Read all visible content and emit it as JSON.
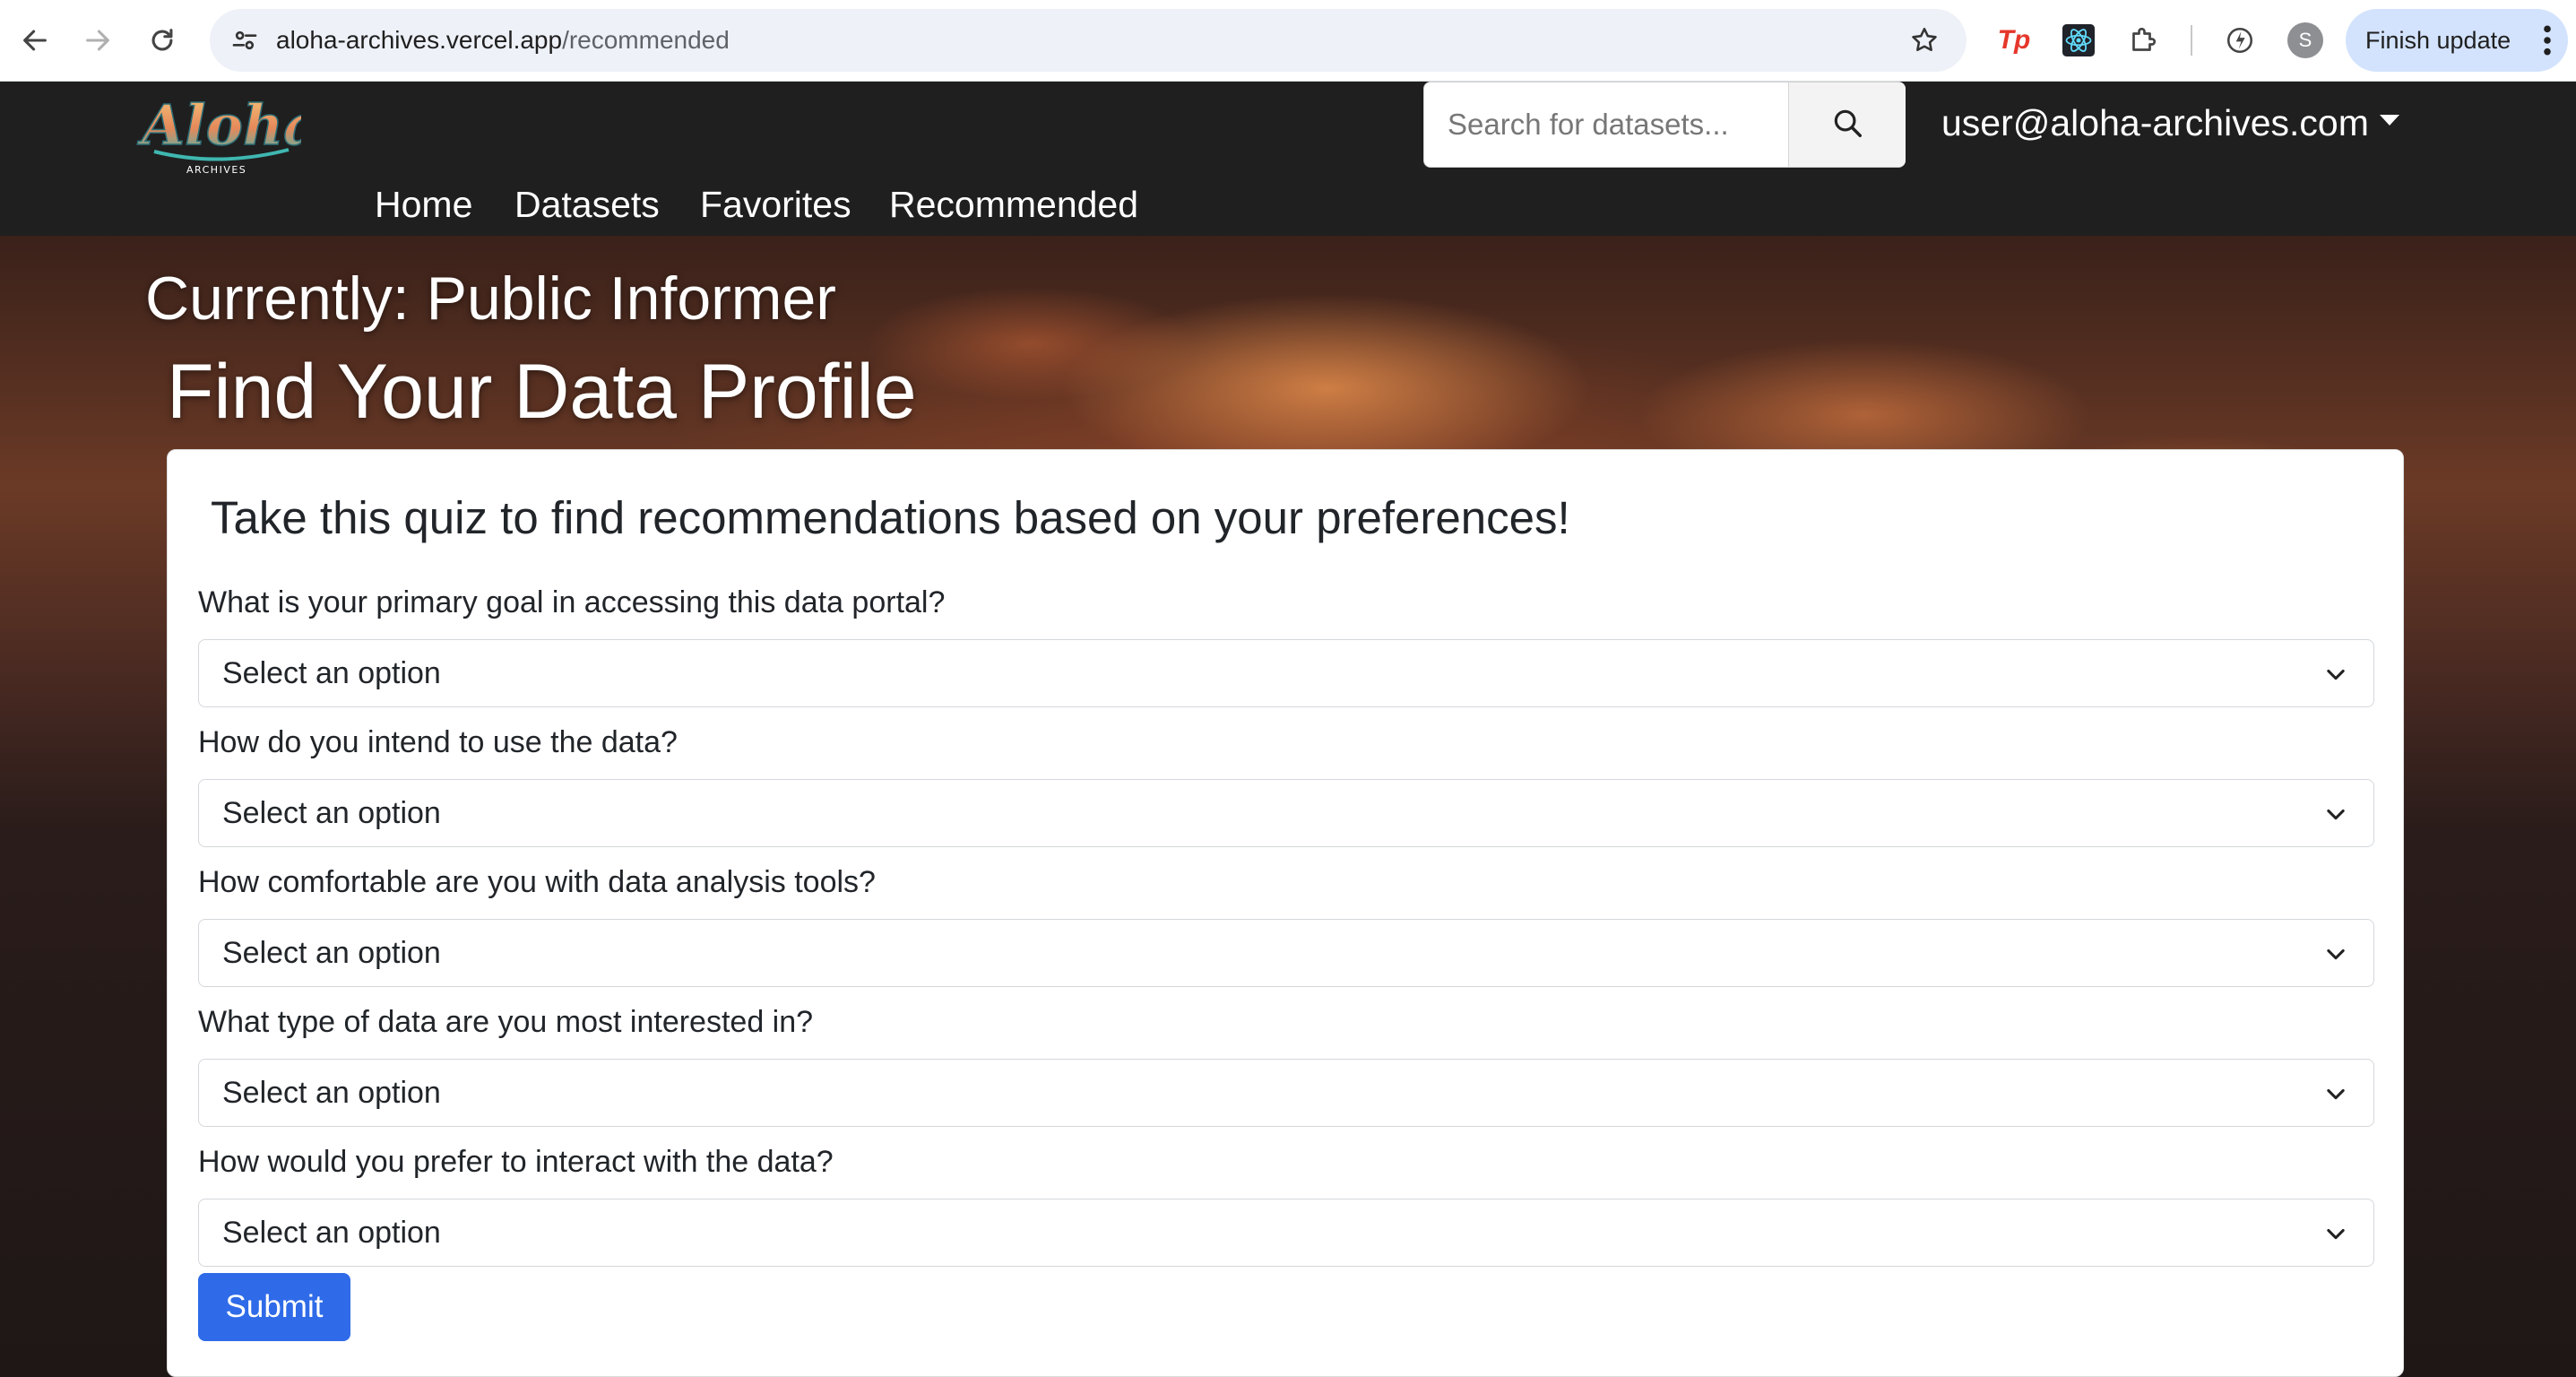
{
  "browser": {
    "url_host": "aloha-archives.vercel.app",
    "url_path": "/recommended",
    "profile_initial": "S",
    "finish_update_label": "Finish update",
    "icons": [
      "back-icon",
      "forward-icon",
      "reload-icon",
      "site-info-icon",
      "bookmark-star-icon",
      "tp-extension-icon",
      "react-extension-icon",
      "extensions-puzzle-icon",
      "performance-icon",
      "more-vert-icon"
    ]
  },
  "site_nav": {
    "logo_alt": "Aloha Archives",
    "links": [
      "Home",
      "Datasets",
      "Favorites",
      "Recommended"
    ],
    "search_placeholder": "Search for datasets...",
    "user_email": "user@aloha-archives.com"
  },
  "hero": {
    "current_profile": "Currently: Public Informer",
    "title": "Find Your Data Profile"
  },
  "quiz": {
    "heading": "Take this quiz to find recommendations based on your preferences!",
    "questions": [
      {
        "label": "What is your primary goal in accessing this data portal?",
        "selected": "Select an option"
      },
      {
        "label": "How do you intend to use the data?",
        "selected": "Select an option"
      },
      {
        "label": "How comfortable are you with data analysis tools?",
        "selected": "Select an option"
      },
      {
        "label": "What type of data are you most interested in?",
        "selected": "Select an option"
      },
      {
        "label": "How would you prefer to interact with the data?",
        "selected": "Select an option"
      }
    ],
    "submit_label": "Submit"
  },
  "colors": {
    "navbar_bg": "#1f1f1f",
    "submit_blue": "#2f6be8",
    "update_pill": "#d3e3fd"
  }
}
